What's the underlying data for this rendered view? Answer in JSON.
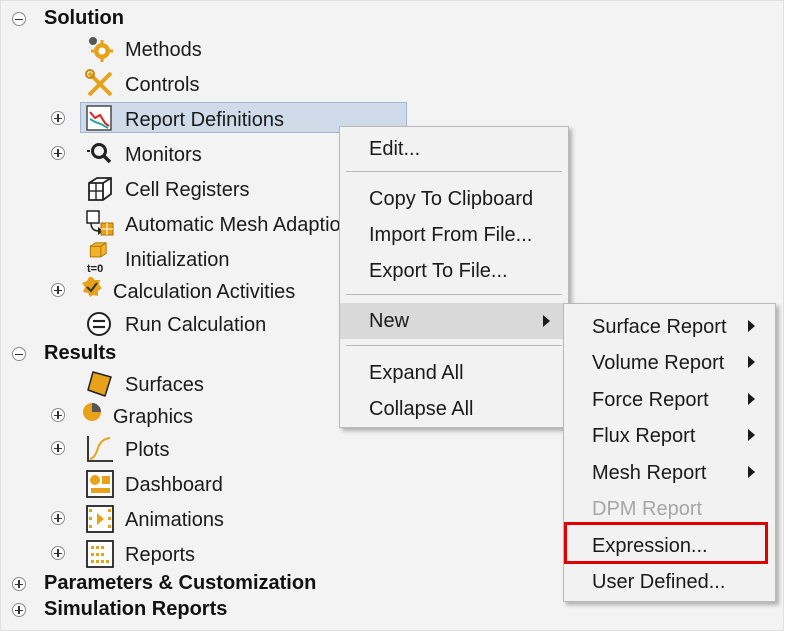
{
  "tree": {
    "solution": {
      "label": "Solution",
      "items": {
        "methods": "Methods",
        "controls": "Controls",
        "report_definitions": "Report Definitions",
        "monitors": "Monitors",
        "cell_registers": "Cell Registers",
        "mesh_adaption": "Automatic Mesh Adaption",
        "initialization": "Initialization",
        "calculation_activities": "Calculation Activities",
        "run_calculation": "Run Calculation"
      }
    },
    "results": {
      "label": "Results",
      "items": {
        "surfaces": "Surfaces",
        "graphics": "Graphics",
        "plots": "Plots",
        "dashboard": "Dashboard",
        "animations": "Animations",
        "reports": "Reports"
      }
    },
    "parameters": {
      "label": "Parameters & Customization"
    },
    "simulation_reports": {
      "label": "Simulation Reports"
    }
  },
  "context_menu": {
    "edit": "Edit...",
    "copy": "Copy To Clipboard",
    "import": "Import From File...",
    "export": "Export To File...",
    "new": "New",
    "expand_all": "Expand All",
    "collapse_all": "Collapse All"
  },
  "submenu": {
    "surface_report": "Surface Report",
    "volume_report": "Volume Report",
    "force_report": "Force Report",
    "flux_report": "Flux Report",
    "mesh_report": "Mesh Report",
    "dpm_report": "DPM Report",
    "expression": "Expression...",
    "user_defined": "User Defined..."
  },
  "icon_text": {
    "initialization_tag": "t=0"
  },
  "colors": {
    "selection": "#cfdbe9",
    "highlight_box": "#e00000",
    "menu_bg": "#f2f2f2"
  }
}
